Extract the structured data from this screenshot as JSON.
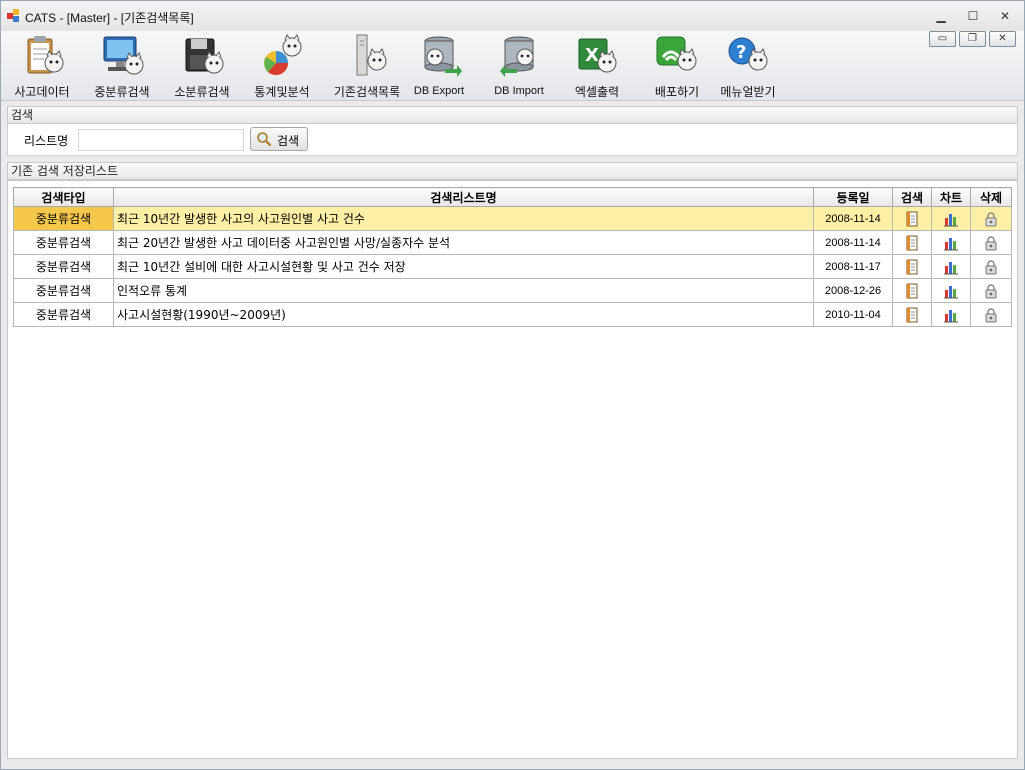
{
  "window": {
    "title": "CATS - [Master] - [기존검색목록]",
    "controls": {
      "minimize": "▁",
      "maximize": "☐",
      "close": "✕"
    }
  },
  "toolbar": {
    "items": [
      {
        "label": "사고데이터",
        "icon": "clipboard-cat-icon"
      },
      {
        "label": "중분류검색",
        "icon": "monitor-cat-icon"
      },
      {
        "label": "소분류검색",
        "icon": "floppy-cat-icon"
      },
      {
        "label": "통계및분석",
        "icon": "pie-chart-cat-icon"
      },
      {
        "label": "기존검색목록",
        "icon": "server-tower-cat-icon"
      },
      {
        "label": "DB Export",
        "icon": "database-export-cat-icon"
      },
      {
        "label": "DB Import",
        "icon": "database-import-cat-icon"
      },
      {
        "label": "엑셀출력",
        "icon": "excel-cat-icon"
      },
      {
        "label": "배포하기",
        "icon": "wifi-cat-icon"
      },
      {
        "label": "메뉴얼받기",
        "icon": "help-cat-icon"
      }
    ]
  },
  "mdi_controls": {
    "minimize": "▭",
    "restore": "❐",
    "close": "✕"
  },
  "search": {
    "group_title": "검색",
    "label": "리스트명",
    "input_value": "",
    "input_placeholder": "",
    "button_label": "검색"
  },
  "list": {
    "group_title": "기존 검색 저장리스트",
    "columns": [
      "검색타입",
      "검색리스트명",
      "등록일",
      "검색",
      "차트",
      "삭제"
    ],
    "rows": [
      {
        "type": "중분류검색",
        "name": "최근 10년간 발생한 사고의 사고원인별 사고 건수",
        "date": "2008-11-14",
        "selected": true
      },
      {
        "type": "중분류검색",
        "name": "최근 20년간 발생한 사고 데이터중 사고원인별 사망/실종자수 분석",
        "date": "2008-11-14",
        "selected": false
      },
      {
        "type": "중분류검색",
        "name": "최근 10년간 설비에 대한 사고시설현황 및 사고 건수 저장",
        "date": "2008-11-17",
        "selected": false
      },
      {
        "type": "중분류검색",
        "name": "인적오류 통계",
        "date": "2008-12-26",
        "selected": false
      },
      {
        "type": "중분류검색",
        "name": "사고시설현황(1990년~2009년)",
        "date": "2010-11-04",
        "selected": false
      }
    ],
    "row_icons": {
      "search": "notebook-icon",
      "chart": "bar-chart-icon",
      "delete": "lock-delete-icon"
    }
  },
  "colors": {
    "selected_row": "#fff0a6",
    "selected_cell": "#f5c84b"
  }
}
